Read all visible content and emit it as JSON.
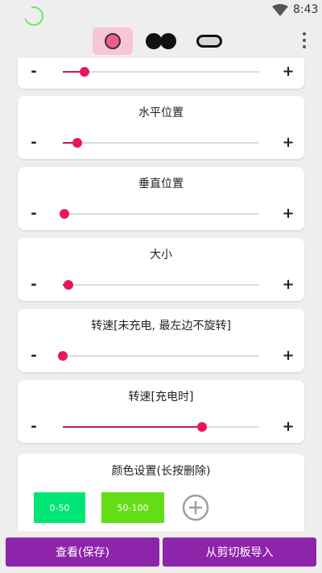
{
  "status_bar": {
    "time": "8:43"
  },
  "toolbar": {
    "modes": [
      "circle",
      "dots",
      "pill"
    ],
    "active_mode": "circle"
  },
  "cards": [
    {
      "title": "",
      "value": 0.11
    },
    {
      "title": "水平位置",
      "value": 0.075
    },
    {
      "title": "垂直位置",
      "value": 0.01
    },
    {
      "title": "大小",
      "value": 0.03
    },
    {
      "title": "转速[未充电, 最左边不旋转]",
      "value": 0.0
    },
    {
      "title": "转速[充电时]",
      "value": 0.71
    }
  ],
  "slider_controls": {
    "minus": "-",
    "plus": "+"
  },
  "color_settings": {
    "title": "颜色设置(长按删除)",
    "chips": [
      {
        "label": "0-50",
        "color": "#00e676"
      },
      {
        "label": "50-100",
        "color": "#64dd17"
      }
    ]
  },
  "bottom": {
    "view_save": "查看(保存)",
    "import_clipboard": "从剪切板导入"
  },
  "colors": {
    "accent": "#e8175d",
    "button": "#8e24aa"
  }
}
